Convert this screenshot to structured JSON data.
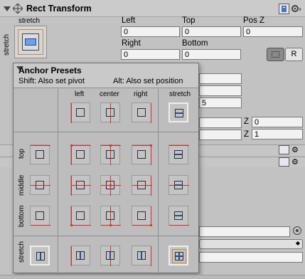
{
  "component": {
    "title": "Rect Transform",
    "anchor_label_top": "stretch",
    "anchor_label_side": "stretch"
  },
  "fields": {
    "left_label": "Left",
    "left_value": "0",
    "top_label": "Top",
    "top_value": "0",
    "posz_label": "Pos Z",
    "posz_value": "0",
    "right_label": "Right",
    "right_value": "0",
    "bottom_label": "Bottom",
    "bottom_value": "0",
    "partial_value": "5",
    "z_label_1": "Z",
    "z_value_1": "0",
    "z_label_2": "Z",
    "z_value_2": "1"
  },
  "buttons": {
    "raw_edit": "",
    "reset": "R"
  },
  "popup": {
    "title": "Anchor Presets",
    "shift_hint": "Shift: Also set pivot",
    "alt_hint": "Alt: Also set position",
    "col_headers": [
      "left",
      "center",
      "right",
      "stretch"
    ],
    "row_headers": [
      "top",
      "middle",
      "bottom",
      "stretch"
    ]
  },
  "icons": {
    "book": "book-icon",
    "gear": "gear-icon",
    "move": "move-icon",
    "fold": "foldout-arrow-icon",
    "target": "target-icon"
  }
}
